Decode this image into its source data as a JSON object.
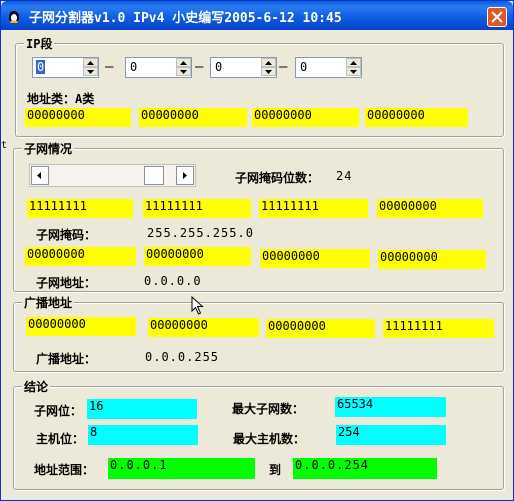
{
  "window": {
    "title": "子网分割器v1.0 IPv4 小史编写2005-6-12 10:45"
  },
  "ip_section": {
    "title": "IP段",
    "octets": [
      "0",
      "0",
      "0",
      "0"
    ],
    "separator": "—",
    "address_class_label": "地址类：A类",
    "binary": [
      "00000000",
      "00000000",
      "00000000",
      "00000000"
    ]
  },
  "subnet_section": {
    "title": "子网情况",
    "mask_bits_label": "子网掩码位数：",
    "mask_bits_value": "24",
    "mask_binary": [
      "11111111",
      "11111111",
      "11111111",
      "00000000"
    ],
    "mask_label": "子网掩码：",
    "mask_value": "255.255.255.0",
    "address_binary": [
      "00000000",
      "00000000",
      "00000000",
      "00000000"
    ],
    "address_label": "子网地址：",
    "address_value": "0.0.0.0"
  },
  "broadcast_section": {
    "title": "广播地址",
    "binary": [
      "00000000",
      "00000000",
      "00000000",
      "11111111"
    ],
    "label": "广播地址：",
    "value": "0.0.0.255"
  },
  "conclusion_section": {
    "title": "结论",
    "subnet_bits_label": "子网位：",
    "subnet_bits_value": "16",
    "max_subnets_label": "最大子网数：",
    "max_subnets_value": "65534",
    "host_bits_label": "主机位：",
    "host_bits_value": "8",
    "max_hosts_label": "最大主机数：",
    "max_hosts_value": "254",
    "range_label": "地址范围：",
    "range_start": "0.0.0.1",
    "range_to": "到",
    "range_end": "0.0.0.254"
  },
  "stray_char": "t",
  "colors": {
    "binary_box": "#ffff00",
    "result_box": "#00ffff",
    "range_box": "#00ff00",
    "titlebar": "#0a5bd8"
  }
}
